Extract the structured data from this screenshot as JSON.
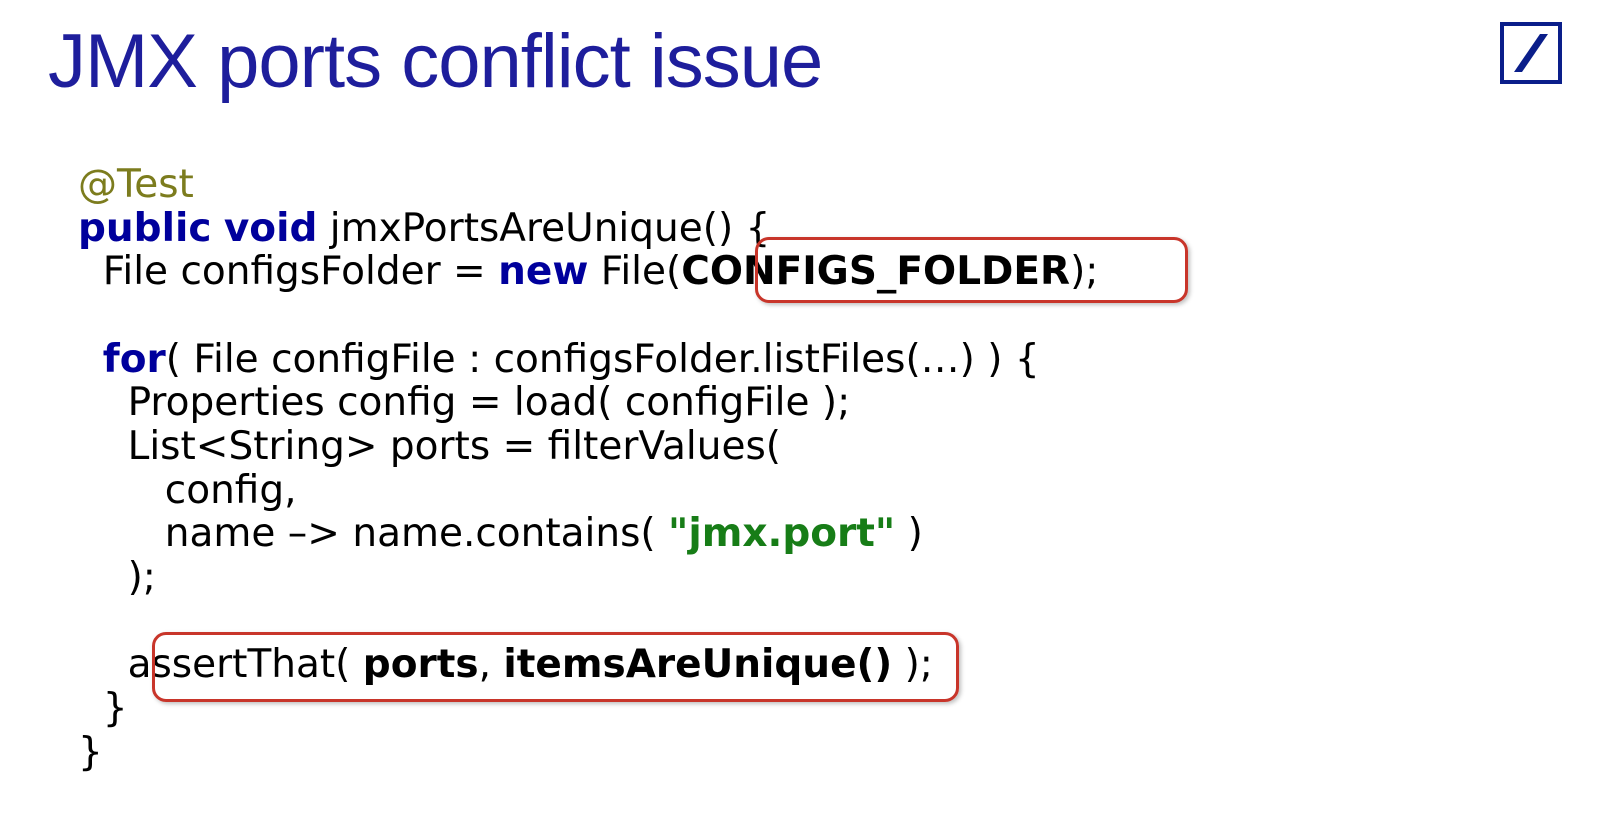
{
  "title": "JMX ports conflict issue",
  "logo": {
    "name": "deutsche-bank-logo"
  },
  "code": {
    "l1_annot": "@Test",
    "l2_pre": "",
    "l2_kw1": "public",
    "l2_sp1": " ",
    "l2_kw2": "void",
    "l2_rest": " jmxPortsAreUnique() {",
    "l3_pre": "  File configsFolder = ",
    "l3_kw": "new",
    "l3_mid": " File(",
    "l3_bold": "CONFIGS_FOLDER",
    "l3_end": ");",
    "l4": "",
    "l5_pre": "  ",
    "l5_kw": "for",
    "l5_rest": "( File configFile : configsFolder.listFiles(…) ) {",
    "l6": "    Properties config = load( configFile );",
    "l7": "    List<String> ports = filterValues(",
    "l8": "       config,",
    "l9_pre": "       name –> name.contains( ",
    "l9_str": "\"jmx.port\"",
    "l9_end": " )",
    "l10": "    );",
    "l11": "",
    "l12_pre": "    assertThat( ",
    "l12_b1": "ports",
    "l12_mid": ", ",
    "l12_b2": "itemsAreUnique()",
    "l12_end": " );",
    "l13": "  }",
    "l14": "}"
  }
}
